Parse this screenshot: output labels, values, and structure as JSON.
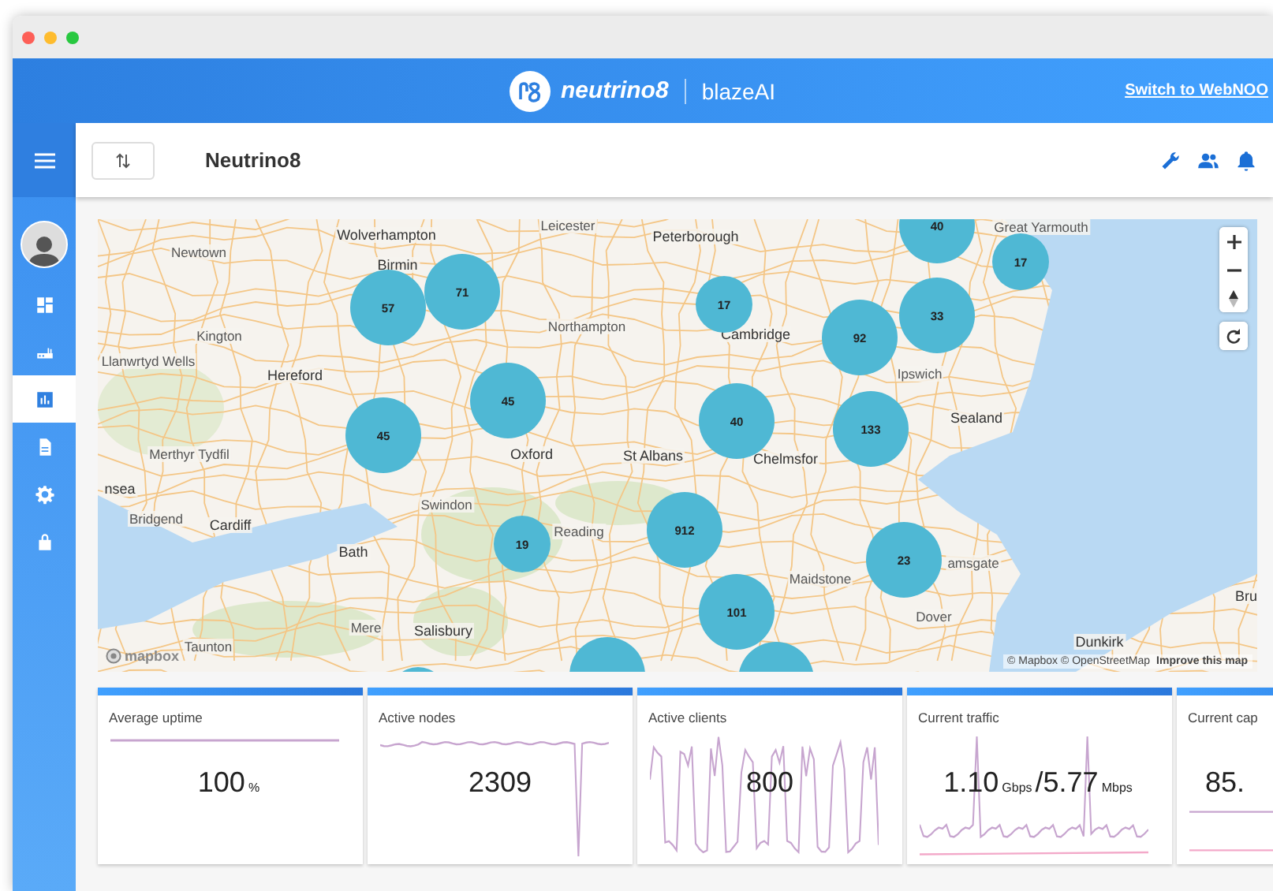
{
  "header": {
    "brand": "neutrino8",
    "product": "blazeAI",
    "link": "Switch to WebNOO"
  },
  "sidebar": {
    "items": [
      {
        "kind": "dashboard",
        "selected": false
      },
      {
        "kind": "router",
        "selected": false
      },
      {
        "kind": "chart",
        "selected": true
      },
      {
        "kind": "document",
        "selected": false
      },
      {
        "kind": "settings",
        "selected": false
      },
      {
        "kind": "lock",
        "selected": false
      }
    ]
  },
  "toolbar": {
    "title": "Neutrino8"
  },
  "map": {
    "places": [
      "Leicester",
      "Wolverhampton",
      "Peterborough",
      "Great Yarmouth",
      "Newtown",
      "Birmin",
      "Kington",
      "Northampton",
      "Cambridge",
      "Llanwrtyd Wells",
      "Hereford",
      "Ipswich",
      "Sealand",
      "Merthyr Tydfil",
      "Oxford",
      "St Albans",
      "Chelmsfor",
      "nsea",
      "Swindon",
      "Bridgend",
      "Cardiff",
      "Reading",
      "Bath",
      "Maidstone",
      "amsgate",
      "Bru",
      "Dover",
      "Mere",
      "Salisbury",
      "Taunton",
      "Dunkirk"
    ],
    "clusters": [
      "57",
      "71",
      "17",
      "40",
      "17",
      "33",
      "92",
      "45",
      "45",
      "40",
      "133",
      "912",
      "19",
      "23",
      "101"
    ],
    "logo": "mapbox",
    "attribution": "© Mapbox © OpenStreetMap",
    "improve_link": "Improve this map"
  },
  "cards": [
    {
      "title": "Average uptime",
      "value": [
        {
          "text": "100",
          "kind": "number"
        },
        {
          "text": "%",
          "kind": "unit"
        }
      ]
    },
    {
      "title": "Active nodes",
      "value": [
        {
          "text": "2309",
          "kind": "number"
        }
      ]
    },
    {
      "title": "Active clients",
      "value": [
        {
          "text": "800",
          "kind": "number"
        }
      ]
    },
    {
      "title": "Current traffic",
      "value": [
        {
          "text": "1.10",
          "kind": "number"
        },
        {
          "text": "Gbps",
          "kind": "unit"
        },
        {
          "text": "/",
          "kind": "number"
        },
        {
          "text": "5.77",
          "kind": "number"
        },
        {
          "text": "Mbps",
          "kind": "unit"
        }
      ]
    },
    {
      "title": "Current cap",
      "value": [
        {
          "text": "85.",
          "kind": "number"
        }
      ]
    }
  ]
}
